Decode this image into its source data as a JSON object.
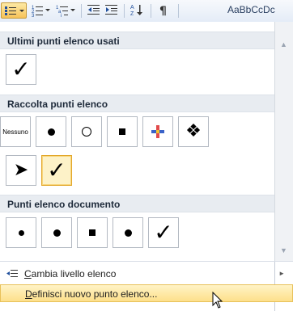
{
  "toolbar": {
    "style_preview": "AaBbCcDc",
    "buttons": [
      "bullets-button",
      "numbering-button",
      "multilevel-list-button",
      "decrease-indent-button",
      "increase-indent-button",
      "sort-button",
      "show-formatting-button"
    ]
  },
  "sections": {
    "recent": "Ultimi punti elenco usati",
    "library": "Raccolta punti elenco",
    "document": "Punti elenco documento"
  },
  "library_none_label": "Nessuno",
  "glyphs": {
    "check": "✓",
    "diamonds": "❖",
    "arrow": "➤",
    "plus": "+"
  },
  "menu": {
    "change_level": {
      "mnemonic": "C",
      "rest": "ambia livello elenco"
    },
    "define_new": {
      "mnemonic": "D",
      "rest": "efinisci nuovo punto elenco..."
    }
  },
  "scrollbar": {
    "up_arrow": "▲",
    "down_arrow": "▼"
  },
  "submenu_arrow": "►",
  "colors": {
    "accent_hover": "#fde08b",
    "selected_border": "#e2a72b",
    "header_bg": "#e8ecf1"
  }
}
